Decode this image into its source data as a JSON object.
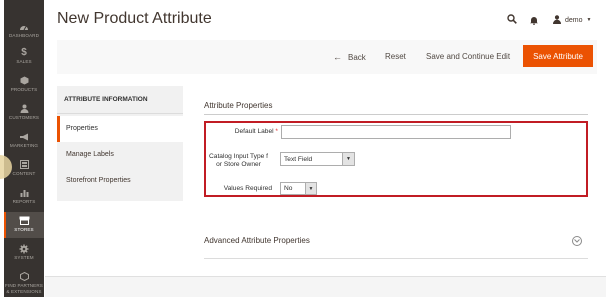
{
  "nav": {
    "items": [
      {
        "label": "DASHBOARD",
        "icon": "dashboard-icon"
      },
      {
        "label": "SALES",
        "icon": "dollar-icon"
      },
      {
        "label": "PRODUCTS",
        "icon": "box-icon"
      },
      {
        "label": "CUSTOMERS",
        "icon": "person-icon"
      },
      {
        "label": "MARKETING",
        "icon": "megaphone-icon"
      },
      {
        "label": "CONTENT",
        "icon": "layout-icon"
      },
      {
        "label": "REPORTS",
        "icon": "bar-chart-icon"
      },
      {
        "label": "STORES",
        "icon": "store-icon"
      },
      {
        "label": "SYSTEM",
        "icon": "gear-icon"
      },
      {
        "label": "FIND PARTNERS\n& EXTENSIONS",
        "icon": "cube-icon"
      }
    ],
    "active": "STORES"
  },
  "header": {
    "title": "New Product Attribute",
    "user": "demo"
  },
  "actions": {
    "back": "Back",
    "reset": "Reset",
    "save_continue": "Save and Continue Edit",
    "save": "Save Attribute"
  },
  "tabs": {
    "heading": "ATTRIBUTE INFORMATION",
    "items": [
      "Properties",
      "Manage Labels",
      "Storefront Properties"
    ]
  },
  "form": {
    "section_title": "Attribute Properties",
    "default_label": "Default Label",
    "default_label_value": "",
    "input_type_label_1": "Catalog Input Type f",
    "input_type_label_2": "or Store Owner",
    "input_type_value": "Text Field",
    "values_required_label": "Values Required",
    "values_required_value": "No",
    "advanced_title": "Advanced Attribute Properties"
  },
  "colors": {
    "accent": "#eb5202",
    "highlight": "#c11c24",
    "nav_bg": "#373330"
  }
}
